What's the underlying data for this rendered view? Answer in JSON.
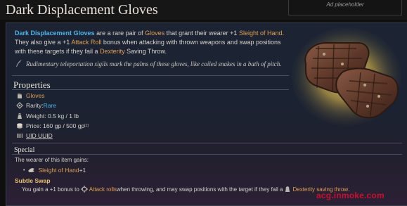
{
  "page": {
    "title": "Dark Displacement Gloves",
    "ad_label": "Ad placeholder"
  },
  "intro": {
    "item_name": "Dark Displacement Gloves",
    "t1": " are a rare pair of ",
    "gloves_link": "Gloves",
    "t2": " that grant their wearer +1 ",
    "sleight_link": "Sleight of Hand",
    "t3": ". They also give a +1 ",
    "attack_roll_link": "Attack Roll",
    "t4": " bonus when attacking with thrown weapons and swap positions with these targets if they fail a ",
    "dex_link": "Dexterity",
    "t5": " Saving Throw."
  },
  "flavor_text": "Rudimentary teleportation sigils mark the palms of these gloves, like coiled snakes in a bath of pitch.",
  "properties": {
    "header": "Properties",
    "category": "Gloves",
    "rarity_label": "Rarity: ",
    "rarity_value": "Rare",
    "weight": "Weight: 0.5 kg / 1 lb",
    "price": "Price: 160 gp / 500 gp",
    "price_note": "[1]",
    "uid": "UID UUID"
  },
  "special": {
    "header": "Special",
    "intro": "The wearer of this item gains:",
    "boost_link": "Sleight of Hand",
    "boost_value": " +1",
    "feature_title": "Subtle Swap",
    "desc_t1": "You gain a +1 bonus to ",
    "desc_link1": "Attack rolls",
    "desc_t2": " when throwing, and may swap positions with the target if they fail a ",
    "desc_link2": "Dexterity saving throw",
    "desc_t3": "."
  },
  "watermark": "acg.inmoke.com",
  "colors": {
    "link_blue": "#4fb4e8",
    "link_orange": "#e0a050",
    "subtle_title": "#e8c270",
    "watermark": "#c8102e"
  },
  "icons": {
    "flavor": "quill-icon",
    "category": "gloves-icon",
    "rarity": "rarity-icon",
    "weight": "weight-icon",
    "price": "coin-icon",
    "uid": "barcode-icon",
    "boost": "hand-icon",
    "attack": "crosshair-icon",
    "dexterity": "dexterity-icon"
  }
}
